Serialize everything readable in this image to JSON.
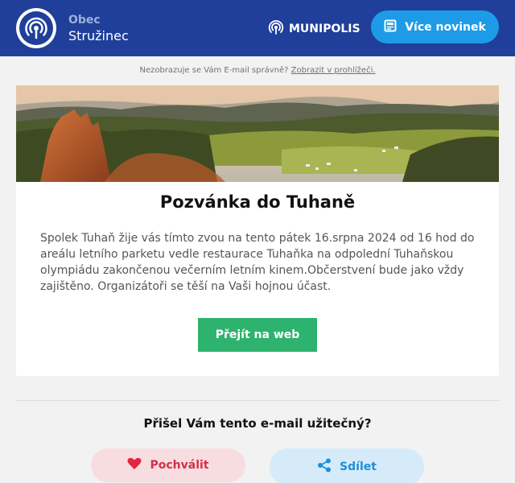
{
  "header": {
    "town_prefix": "Obec",
    "town_name": "Stružinec",
    "brand": "MUNIPOLIS",
    "more_news_label": "Více novinek"
  },
  "notice": {
    "text": "Nezobrazuje se Vám E-mail správně?",
    "link_label": "Zobrazit v prohlížeči."
  },
  "article": {
    "title": "Pozvánka do Tuhaně",
    "body": "Spolek Tuhaň žije vás tímto zvou na tento pátek 16.srpna 2024 od 16 hod do areálu letního parketu vedle restaurace Tuhaňka na odpolední Tuhaňskou olympiádu zakončenou večerním letním kinem.Občerstvení bude jako vždy zajištěno. Organizátoři se těší na Vaši hojnou účast.",
    "button_label": "Přejít na web"
  },
  "feedback": {
    "question": "Přišel Vám tento e-mail užitečný?",
    "praise_label": "Pochválit",
    "share_label": "Sdílet"
  },
  "colors": {
    "header_bg": "#1f3f9a",
    "accent_blue": "#1e9be6",
    "button_green": "#2db36e",
    "praise_red": "#d32f47"
  },
  "icons": {
    "logo": "broadcast-icon",
    "brand": "broadcast-icon",
    "more_news": "newspaper-icon",
    "praise": "heart-icon",
    "share": "share-icon"
  }
}
